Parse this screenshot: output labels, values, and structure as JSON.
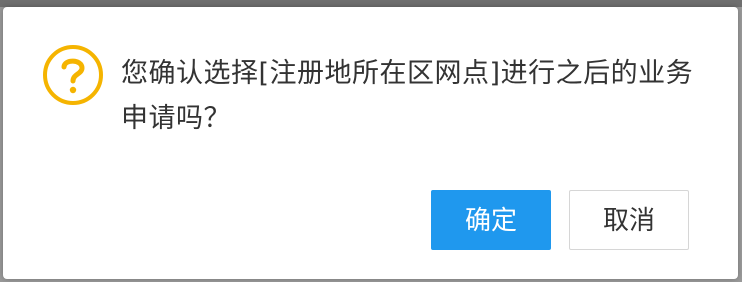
{
  "dialog": {
    "message": "您确认选择[注册地所在区网点]进行之后的业务申请吗？",
    "confirm_label": "确定",
    "cancel_label": "取消",
    "icon": "question-icon"
  },
  "colors": {
    "icon_accent": "#f5b400",
    "confirm_bg": "#1f98ee",
    "text": "#333333"
  }
}
